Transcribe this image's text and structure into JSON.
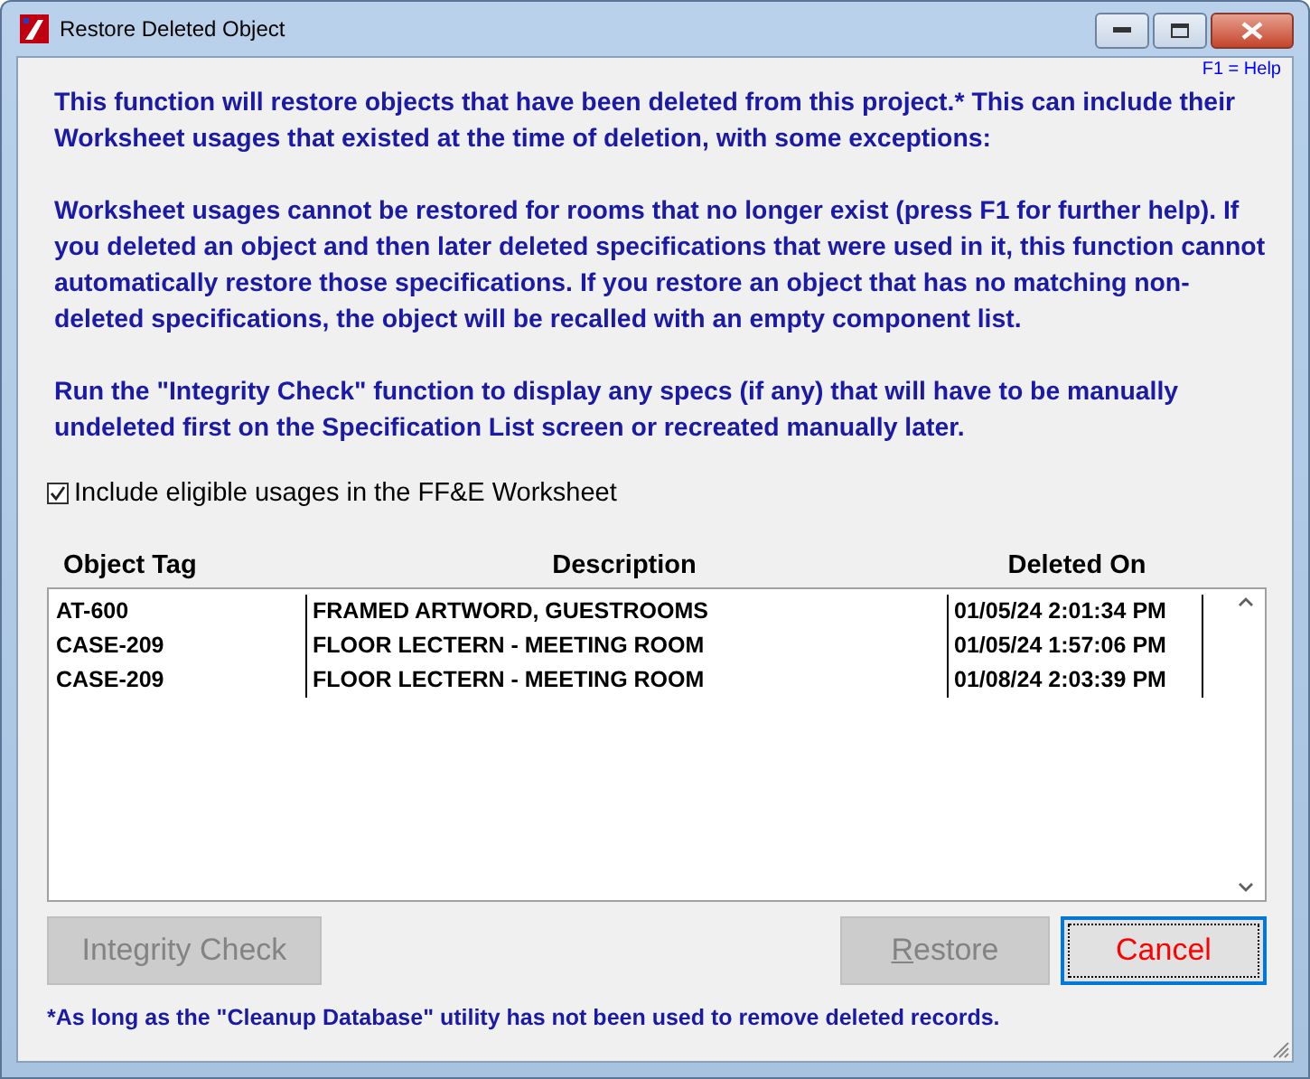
{
  "window": {
    "title": "Restore Deleted Object"
  },
  "help_hint": "F1 = Help",
  "paragraphs": [
    "This function will restore objects that have been deleted from this project.* This can include their Worksheet usages that existed at the time of deletion, with some exceptions:",
    "Worksheet usages cannot be restored for rooms that no longer exist (press F1 for further help). If you deleted an object and then later deleted specifications that were used in it, this function cannot automatically restore those specifications. If you restore an object that has no matching non-deleted specifications, the object will be recalled with an empty component list.",
    "Run the \"Integrity Check\" function to display any specs (if any) that will have to be manually undeleted first on the Specification List screen or recreated manually later."
  ],
  "include_option": {
    "label": "Include eligible usages in the FF&E Worksheet",
    "checked": true
  },
  "table": {
    "columns": [
      "Object Tag",
      "Description",
      "Deleted On"
    ],
    "rows": [
      {
        "tag": "AT-600",
        "description": "FRAMED ARTWORD, GUESTROOMS",
        "deleted_on": "01/05/24 2:01:34 PM"
      },
      {
        "tag": "CASE-209",
        "description": "FLOOR LECTERN - MEETING ROOM",
        "deleted_on": "01/05/24 1:57:06 PM"
      },
      {
        "tag": "CASE-209",
        "description": "FLOOR LECTERN - MEETING ROOM",
        "deleted_on": "01/08/24 2:03:39 PM"
      }
    ]
  },
  "buttons": [
    {
      "label": "Integrity Check",
      "disabled": true,
      "mnemonic": false,
      "default": false
    },
    {
      "label": "Restore",
      "disabled": true,
      "mnemonic": true,
      "default": false
    },
    {
      "label": "Cancel",
      "disabled": false,
      "mnemonic": false,
      "default": true
    }
  ],
  "footnote": "*As long as the \"Cleanup Database\" utility has not been used to remove deleted records."
}
